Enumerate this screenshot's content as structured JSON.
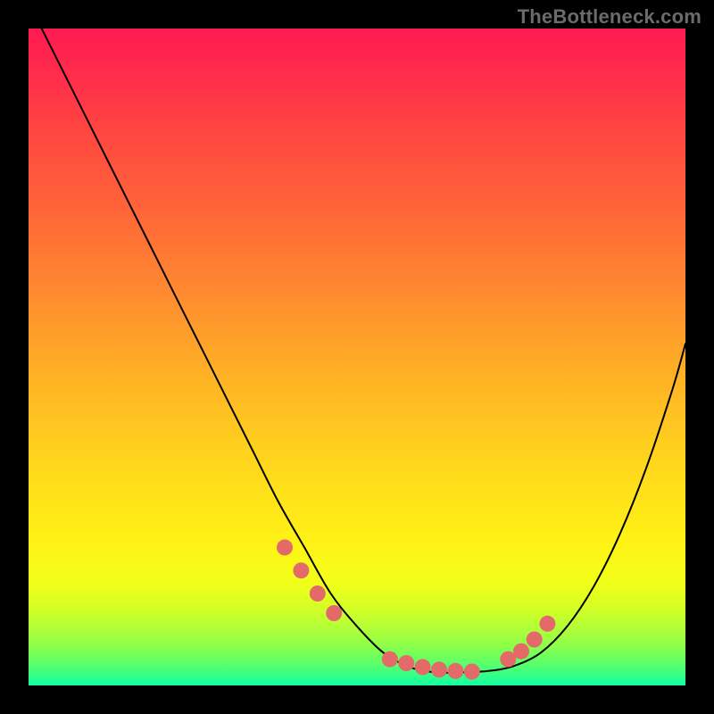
{
  "watermark": "TheBottleneck.com",
  "colors": {
    "dot": "#e46a6a",
    "line": "#000000",
    "frame": "#000000"
  },
  "chart_data": {
    "type": "line",
    "title": "",
    "xlabel": "",
    "ylabel": "",
    "xlim": [
      0,
      100
    ],
    "ylim": [
      0,
      100
    ],
    "grid": false,
    "series": [
      {
        "name": "bottleneck-curve",
        "x": [
          2,
          6,
          10,
          14,
          18,
          22,
          26,
          30,
          34,
          38,
          42,
          46,
          50,
          54,
          58,
          62,
          66,
          70,
          74,
          78,
          82,
          86,
          90,
          94,
          98,
          100
        ],
        "values": [
          100,
          92,
          84,
          76,
          68,
          60,
          52,
          44,
          36,
          28,
          21,
          14,
          9,
          5,
          2.8,
          2,
          2,
          2.2,
          3,
          5,
          9,
          15,
          23,
          33,
          45,
          52
        ]
      }
    ],
    "markers": {
      "name": "highlight-dots",
      "x": [
        39,
        41.5,
        44,
        46.5,
        55,
        57.5,
        60,
        62.5,
        65,
        67.5,
        73,
        75,
        77,
        79
      ],
      "values": [
        21,
        17.5,
        14,
        11,
        4,
        3.4,
        2.8,
        2.4,
        2.2,
        2.1,
        4,
        5.2,
        7,
        9.4
      ]
    }
  }
}
